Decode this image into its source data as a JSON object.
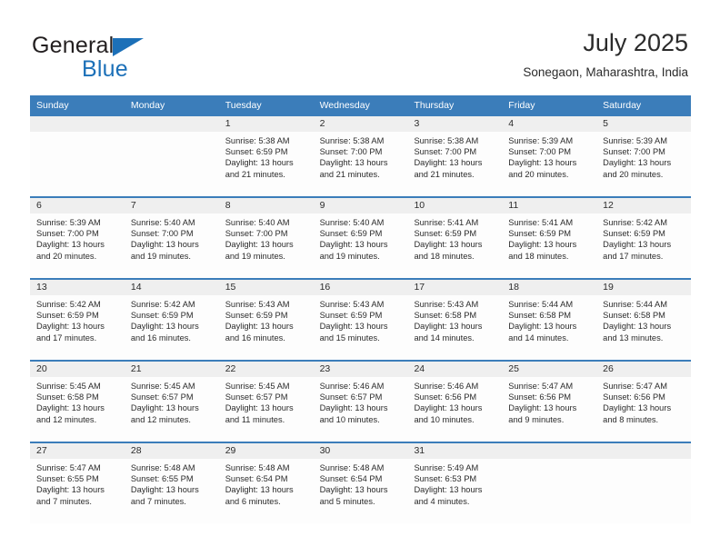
{
  "brand": {
    "word_one": "General",
    "word_two": "Blue",
    "triangle_icon": "triangle-icon",
    "accent_blue": "#1c70b8"
  },
  "header": {
    "title": "July 2025",
    "subtitle": "Sonegaon, Maharashtra, India"
  },
  "colors": {
    "header_blue": "#3b7dba",
    "daynum_band": "#efefef",
    "cell_background": "#fdfdfd",
    "text": "#2b2b2b"
  },
  "weekdays": [
    "Sunday",
    "Monday",
    "Tuesday",
    "Wednesday",
    "Thursday",
    "Friday",
    "Saturday"
  ],
  "weeks": [
    [
      {
        "day": "",
        "lines": []
      },
      {
        "day": "",
        "lines": []
      },
      {
        "day": "1",
        "lines": [
          "Sunrise: 5:38 AM",
          "Sunset: 6:59 PM",
          "Daylight: 13 hours",
          "and 21 minutes."
        ]
      },
      {
        "day": "2",
        "lines": [
          "Sunrise: 5:38 AM",
          "Sunset: 7:00 PM",
          "Daylight: 13 hours",
          "and 21 minutes."
        ]
      },
      {
        "day": "3",
        "lines": [
          "Sunrise: 5:38 AM",
          "Sunset: 7:00 PM",
          "Daylight: 13 hours",
          "and 21 minutes."
        ]
      },
      {
        "day": "4",
        "lines": [
          "Sunrise: 5:39 AM",
          "Sunset: 7:00 PM",
          "Daylight: 13 hours",
          "and 20 minutes."
        ]
      },
      {
        "day": "5",
        "lines": [
          "Sunrise: 5:39 AM",
          "Sunset: 7:00 PM",
          "Daylight: 13 hours",
          "and 20 minutes."
        ]
      }
    ],
    [
      {
        "day": "6",
        "lines": [
          "Sunrise: 5:39 AM",
          "Sunset: 7:00 PM",
          "Daylight: 13 hours",
          "and 20 minutes."
        ]
      },
      {
        "day": "7",
        "lines": [
          "Sunrise: 5:40 AM",
          "Sunset: 7:00 PM",
          "Daylight: 13 hours",
          "and 19 minutes."
        ]
      },
      {
        "day": "8",
        "lines": [
          "Sunrise: 5:40 AM",
          "Sunset: 7:00 PM",
          "Daylight: 13 hours",
          "and 19 minutes."
        ]
      },
      {
        "day": "9",
        "lines": [
          "Sunrise: 5:40 AM",
          "Sunset: 6:59 PM",
          "Daylight: 13 hours",
          "and 19 minutes."
        ]
      },
      {
        "day": "10",
        "lines": [
          "Sunrise: 5:41 AM",
          "Sunset: 6:59 PM",
          "Daylight: 13 hours",
          "and 18 minutes."
        ]
      },
      {
        "day": "11",
        "lines": [
          "Sunrise: 5:41 AM",
          "Sunset: 6:59 PM",
          "Daylight: 13 hours",
          "and 18 minutes."
        ]
      },
      {
        "day": "12",
        "lines": [
          "Sunrise: 5:42 AM",
          "Sunset: 6:59 PM",
          "Daylight: 13 hours",
          "and 17 minutes."
        ]
      }
    ],
    [
      {
        "day": "13",
        "lines": [
          "Sunrise: 5:42 AM",
          "Sunset: 6:59 PM",
          "Daylight: 13 hours",
          "and 17 minutes."
        ]
      },
      {
        "day": "14",
        "lines": [
          "Sunrise: 5:42 AM",
          "Sunset: 6:59 PM",
          "Daylight: 13 hours",
          "and 16 minutes."
        ]
      },
      {
        "day": "15",
        "lines": [
          "Sunrise: 5:43 AM",
          "Sunset: 6:59 PM",
          "Daylight: 13 hours",
          "and 16 minutes."
        ]
      },
      {
        "day": "16",
        "lines": [
          "Sunrise: 5:43 AM",
          "Sunset: 6:59 PM",
          "Daylight: 13 hours",
          "and 15 minutes."
        ]
      },
      {
        "day": "17",
        "lines": [
          "Sunrise: 5:43 AM",
          "Sunset: 6:58 PM",
          "Daylight: 13 hours",
          "and 14 minutes."
        ]
      },
      {
        "day": "18",
        "lines": [
          "Sunrise: 5:44 AM",
          "Sunset: 6:58 PM",
          "Daylight: 13 hours",
          "and 14 minutes."
        ]
      },
      {
        "day": "19",
        "lines": [
          "Sunrise: 5:44 AM",
          "Sunset: 6:58 PM",
          "Daylight: 13 hours",
          "and 13 minutes."
        ]
      }
    ],
    [
      {
        "day": "20",
        "lines": [
          "Sunrise: 5:45 AM",
          "Sunset: 6:58 PM",
          "Daylight: 13 hours",
          "and 12 minutes."
        ]
      },
      {
        "day": "21",
        "lines": [
          "Sunrise: 5:45 AM",
          "Sunset: 6:57 PM",
          "Daylight: 13 hours",
          "and 12 minutes."
        ]
      },
      {
        "day": "22",
        "lines": [
          "Sunrise: 5:45 AM",
          "Sunset: 6:57 PM",
          "Daylight: 13 hours",
          "and 11 minutes."
        ]
      },
      {
        "day": "23",
        "lines": [
          "Sunrise: 5:46 AM",
          "Sunset: 6:57 PM",
          "Daylight: 13 hours",
          "and 10 minutes."
        ]
      },
      {
        "day": "24",
        "lines": [
          "Sunrise: 5:46 AM",
          "Sunset: 6:56 PM",
          "Daylight: 13 hours",
          "and 10 minutes."
        ]
      },
      {
        "day": "25",
        "lines": [
          "Sunrise: 5:47 AM",
          "Sunset: 6:56 PM",
          "Daylight: 13 hours",
          "and 9 minutes."
        ]
      },
      {
        "day": "26",
        "lines": [
          "Sunrise: 5:47 AM",
          "Sunset: 6:56 PM",
          "Daylight: 13 hours",
          "and 8 minutes."
        ]
      }
    ],
    [
      {
        "day": "27",
        "lines": [
          "Sunrise: 5:47 AM",
          "Sunset: 6:55 PM",
          "Daylight: 13 hours",
          "and 7 minutes."
        ]
      },
      {
        "day": "28",
        "lines": [
          "Sunrise: 5:48 AM",
          "Sunset: 6:55 PM",
          "Daylight: 13 hours",
          "and 7 minutes."
        ]
      },
      {
        "day": "29",
        "lines": [
          "Sunrise: 5:48 AM",
          "Sunset: 6:54 PM",
          "Daylight: 13 hours",
          "and 6 minutes."
        ]
      },
      {
        "day": "30",
        "lines": [
          "Sunrise: 5:48 AM",
          "Sunset: 6:54 PM",
          "Daylight: 13 hours",
          "and 5 minutes."
        ]
      },
      {
        "day": "31",
        "lines": [
          "Sunrise: 5:49 AM",
          "Sunset: 6:53 PM",
          "Daylight: 13 hours",
          "and 4 minutes."
        ]
      },
      {
        "day": "",
        "lines": []
      },
      {
        "day": "",
        "lines": []
      }
    ]
  ]
}
